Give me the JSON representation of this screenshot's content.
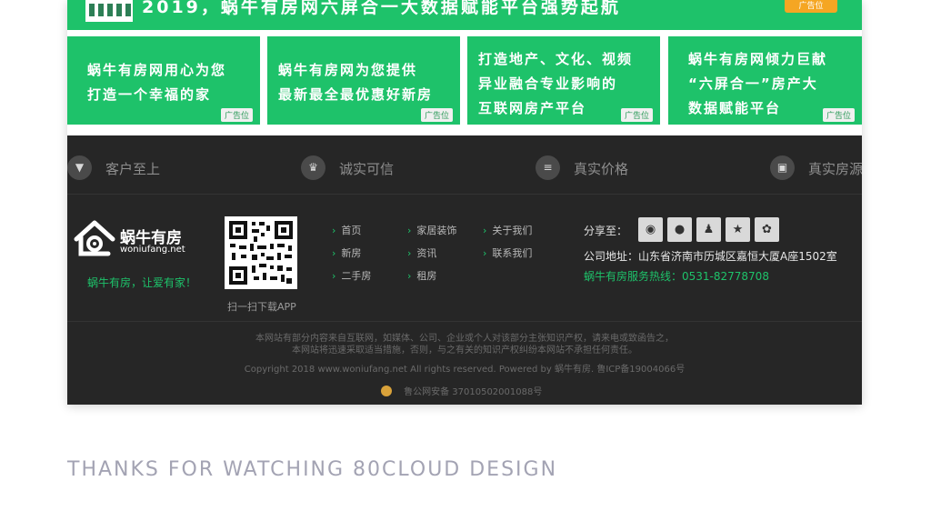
{
  "top_banner": {
    "text": "2019，蜗牛有房网六屏合一大数据赋能平台强势起航",
    "tag": "广告位"
  },
  "ads": [
    {
      "lines": [
        "蜗牛有房网用心为您",
        "打造一个幸福的家"
      ],
      "tag": "广告位"
    },
    {
      "lines": [
        "蜗牛有房网为您提供",
        "最新最全最优惠好新房"
      ],
      "tag": "广告位"
    },
    {
      "lines": [
        "打造地产、文化、视频",
        "异业融合专业影响的",
        "互联网房产平台"
      ],
      "tag": "广告位"
    },
    {
      "lines": [
        "蜗牛有房网倾力巨献",
        "“六屏合一”房产大",
        "数据赋能平台"
      ],
      "tag": "广告位"
    }
  ],
  "features": [
    {
      "label": "客户至上",
      "icon": "tie-icon"
    },
    {
      "label": "诚实可信",
      "icon": "crown-icon"
    },
    {
      "label": "真实价格",
      "icon": "price-tag-icon"
    },
    {
      "label": "真实房源",
      "icon": "image-icon"
    }
  ],
  "logo": {
    "brand": "蜗牛有房",
    "domain": "woniufang.net",
    "slogan": "蜗牛有房，让爱有家！"
  },
  "qr_caption": "扫一扫下载APP",
  "link_columns": [
    [
      "首页",
      "新房",
      "二手房"
    ],
    [
      "家居装饰",
      "资讯",
      "租房"
    ],
    [
      "关于我们",
      "联系我们"
    ]
  ],
  "share": {
    "label": "分享至：",
    "icons": [
      "weibo-icon",
      "wechat-icon",
      "qq-icon",
      "star-icon",
      "baidu-icon"
    ]
  },
  "contact": {
    "address": "公司地址：山东省济南市历城区嘉恒大厦A座1502室",
    "hotline": "蜗牛有房服务热线：0531-82778708"
  },
  "legal": {
    "line1": "本网站有部分内容来自互联网，如媒体、公司、企业或个人对该部分主张知识产权，请来电或致函告之，",
    "line2": "本网站将迅速采取适当措施，否则，与之有关的知识产权纠纷本网站不承担任何责任。",
    "copyright": "Copyright 2018 www.woniufang.net All rights reserved. Powered by 蜗牛有房. 鲁ICP备19004066号",
    "police": "鲁公网安备 37010502001088号"
  },
  "thanks": "THANKS FOR WATCHING  80CLOUD DESIGN",
  "colors": {
    "brand_green": "#1ec26a",
    "footer_bg": "#262626",
    "tag_orange": "#f5a623"
  }
}
